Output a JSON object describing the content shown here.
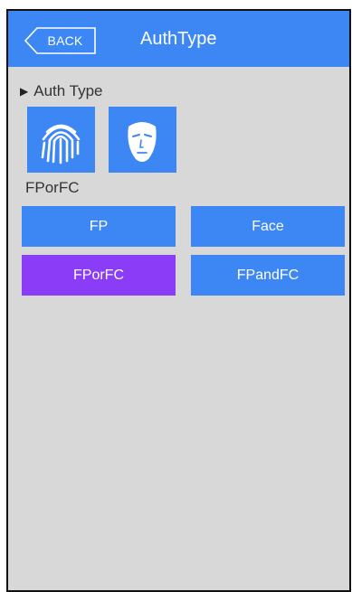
{
  "header": {
    "back_label": "BACK",
    "title": "AuthType"
  },
  "section": {
    "title": "Auth Type"
  },
  "icons": {
    "fingerprint": "fingerprint-icon",
    "face": "face-icon"
  },
  "current_mode": "FPorFC",
  "options": [
    {
      "label": "FP",
      "selected": false
    },
    {
      "label": "Face",
      "selected": false
    },
    {
      "label": "FPorFC",
      "selected": true
    },
    {
      "label": "FPandFC",
      "selected": false
    }
  ],
  "colors": {
    "header_bg": "#3d87f5",
    "button_bg": "#3d87f5",
    "selected_bg": "#8a3cf7",
    "page_bg": "#d8d8d8"
  }
}
